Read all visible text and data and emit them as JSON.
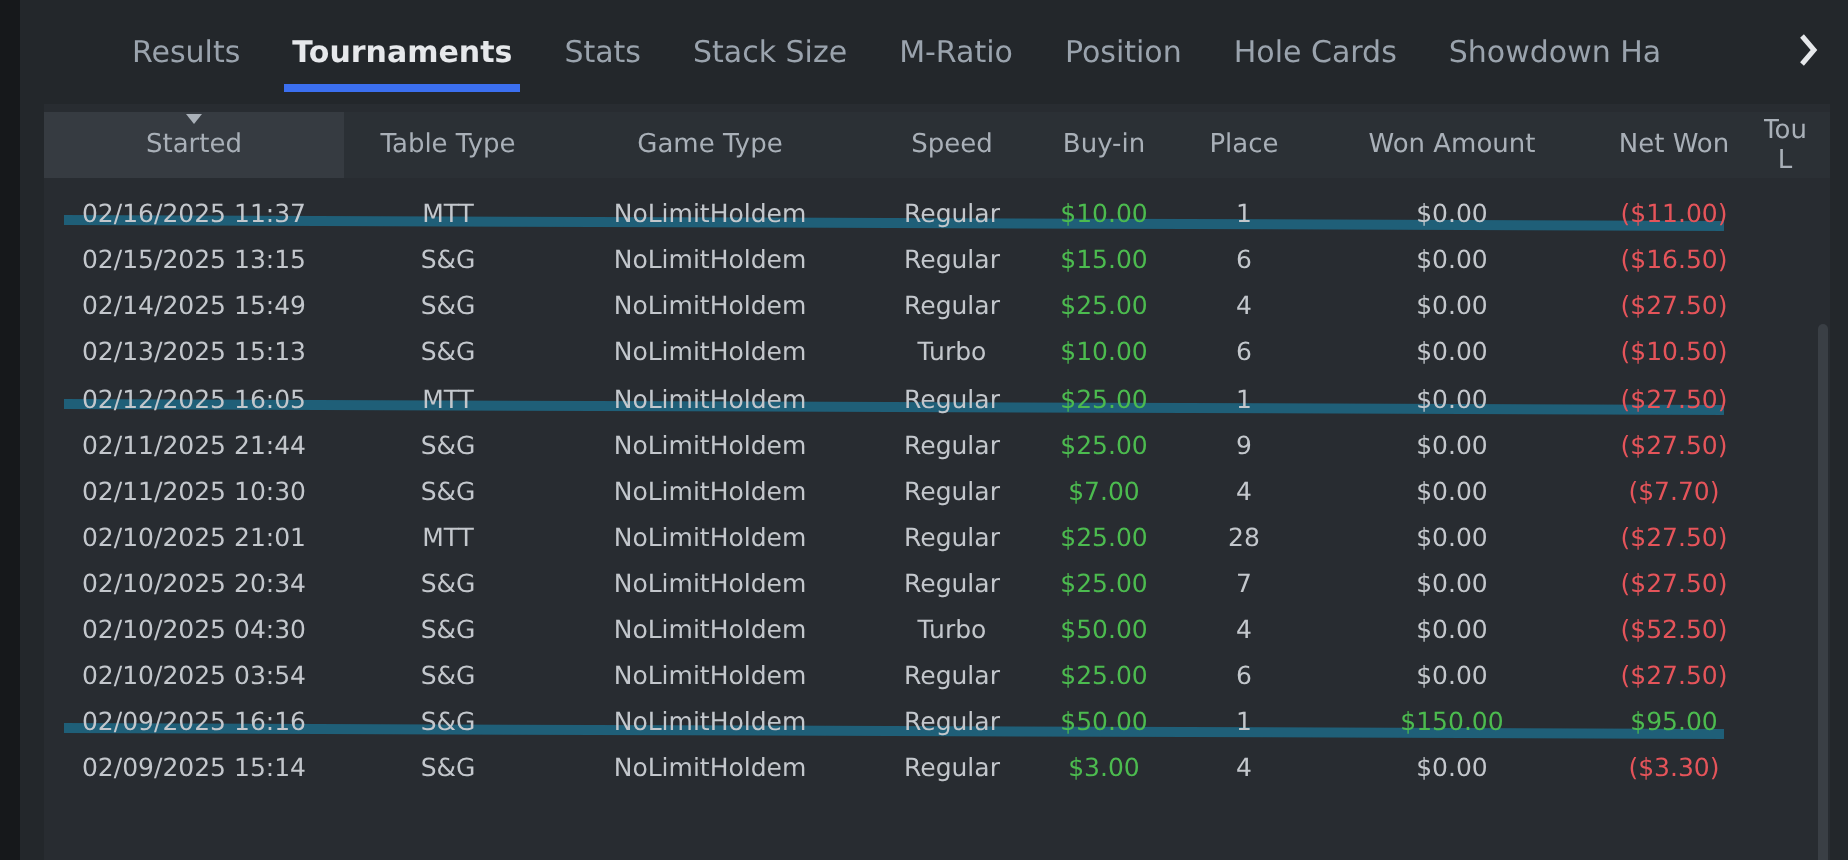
{
  "tabs": [
    {
      "label": "Results",
      "selected": false
    },
    {
      "label": "Tournaments",
      "selected": true
    },
    {
      "label": "Stats",
      "selected": false
    },
    {
      "label": "Stack Size",
      "selected": false
    },
    {
      "label": "M-Ratio",
      "selected": false
    },
    {
      "label": "Position",
      "selected": false
    },
    {
      "label": "Hole Cards",
      "selected": false
    },
    {
      "label": "Showdown Ha",
      "selected": false
    }
  ],
  "table": {
    "columns": [
      {
        "label": "Started",
        "sorted": true
      },
      {
        "label": "Table Type",
        "sorted": false
      },
      {
        "label": "Game Type",
        "sorted": false
      },
      {
        "label": "Speed",
        "sorted": false
      },
      {
        "label": "Buy-in",
        "sorted": false
      },
      {
        "label": "Place",
        "sorted": false
      },
      {
        "label": "Won Amount",
        "sorted": false
      },
      {
        "label": "Net Won",
        "sorted": false
      },
      {
        "label": "Tou L",
        "sorted": false
      }
    ],
    "rows": [
      {
        "started": "02/16/2025 11:37",
        "table_type": "MTT",
        "game_type": "NoLimitHoldem",
        "speed": "Regular",
        "buy_in": "$10.00",
        "place": "1",
        "won_amount": {
          "text": "$0.00",
          "color": "#c3c7cc"
        },
        "net_won": {
          "text": "($11.00)",
          "color": "#e5545a"
        },
        "struck": true
      },
      {
        "started": "02/15/2025 13:15",
        "table_type": "S&G",
        "game_type": "NoLimitHoldem",
        "speed": "Regular",
        "buy_in": "$15.00",
        "place": "6",
        "won_amount": {
          "text": "$0.00",
          "color": "#c3c7cc"
        },
        "net_won": {
          "text": "($16.50)",
          "color": "#e5545a"
        },
        "struck": false
      },
      {
        "started": "02/14/2025 15:49",
        "table_type": "S&G",
        "game_type": "NoLimitHoldem",
        "speed": "Regular",
        "buy_in": "$25.00",
        "place": "4",
        "won_amount": {
          "text": "$0.00",
          "color": "#c3c7cc"
        },
        "net_won": {
          "text": "($27.50)",
          "color": "#e5545a"
        },
        "struck": false
      },
      {
        "started": "02/13/2025 15:13",
        "table_type": "S&G",
        "game_type": "NoLimitHoldem",
        "speed": "Turbo",
        "buy_in": "$10.00",
        "place": "6",
        "won_amount": {
          "text": "$0.00",
          "color": "#c3c7cc"
        },
        "net_won": {
          "text": "($10.50)",
          "color": "#e5545a"
        },
        "struck": false
      },
      {
        "started": "02/12/2025 16:05",
        "table_type": "MTT",
        "game_type": "NoLimitHoldem",
        "speed": "Regular",
        "buy_in": "$25.00",
        "place": "1",
        "won_amount": {
          "text": "$0.00",
          "color": "#c3c7cc"
        },
        "net_won": {
          "text": "($27.50)",
          "color": "#e5545a"
        },
        "struck": true
      },
      {
        "started": "02/11/2025 21:44",
        "table_type": "S&G",
        "game_type": "NoLimitHoldem",
        "speed": "Regular",
        "buy_in": "$25.00",
        "place": "9",
        "won_amount": {
          "text": "$0.00",
          "color": "#c3c7cc"
        },
        "net_won": {
          "text": "($27.50)",
          "color": "#e5545a"
        },
        "struck": false
      },
      {
        "started": "02/11/2025 10:30",
        "table_type": "S&G",
        "game_type": "NoLimitHoldem",
        "speed": "Regular",
        "buy_in": "$7.00",
        "place": "4",
        "won_amount": {
          "text": "$0.00",
          "color": "#c3c7cc"
        },
        "net_won": {
          "text": "($7.70)",
          "color": "#e5545a"
        },
        "struck": false
      },
      {
        "started": "02/10/2025 21:01",
        "table_type": "MTT",
        "game_type": "NoLimitHoldem",
        "speed": "Regular",
        "buy_in": "$25.00",
        "place": "28",
        "won_amount": {
          "text": "$0.00",
          "color": "#c3c7cc"
        },
        "net_won": {
          "text": "($27.50)",
          "color": "#e5545a"
        },
        "struck": false
      },
      {
        "started": "02/10/2025 20:34",
        "table_type": "S&G",
        "game_type": "NoLimitHoldem",
        "speed": "Regular",
        "buy_in": "$25.00",
        "place": "7",
        "won_amount": {
          "text": "$0.00",
          "color": "#c3c7cc"
        },
        "net_won": {
          "text": "($27.50)",
          "color": "#e5545a"
        },
        "struck": false
      },
      {
        "started": "02/10/2025 04:30",
        "table_type": "S&G",
        "game_type": "NoLimitHoldem",
        "speed": "Turbo",
        "buy_in": "$50.00",
        "place": "4",
        "won_amount": {
          "text": "$0.00",
          "color": "#c3c7cc"
        },
        "net_won": {
          "text": "($52.50)",
          "color": "#e5545a"
        },
        "struck": false
      },
      {
        "started": "02/10/2025 03:54",
        "table_type": "S&G",
        "game_type": "NoLimitHoldem",
        "speed": "Regular",
        "buy_in": "$25.00",
        "place": "6",
        "won_amount": {
          "text": "$0.00",
          "color": "#c3c7cc"
        },
        "net_won": {
          "text": "($27.50)",
          "color": "#e5545a"
        },
        "struck": false
      },
      {
        "started": "02/09/2025 16:16",
        "table_type": "S&G",
        "game_type": "NoLimitHoldem",
        "speed": "Regular",
        "buy_in": "$50.00",
        "place": "1",
        "won_amount": {
          "text": "$150.00",
          "color": "#4cbb4f"
        },
        "net_won": {
          "text": "$95.00",
          "color": "#4cbb4f"
        },
        "struck": true
      },
      {
        "started": "02/09/2025 15:14",
        "table_type": "S&G",
        "game_type": "NoLimitHoldem",
        "speed": "Regular",
        "buy_in": "$3.00",
        "place": "4",
        "won_amount": {
          "text": "$0.00",
          "color": "#c3c7cc"
        },
        "net_won": {
          "text": "($3.30)",
          "color": "#e5545a"
        },
        "struck": false
      }
    ]
  }
}
